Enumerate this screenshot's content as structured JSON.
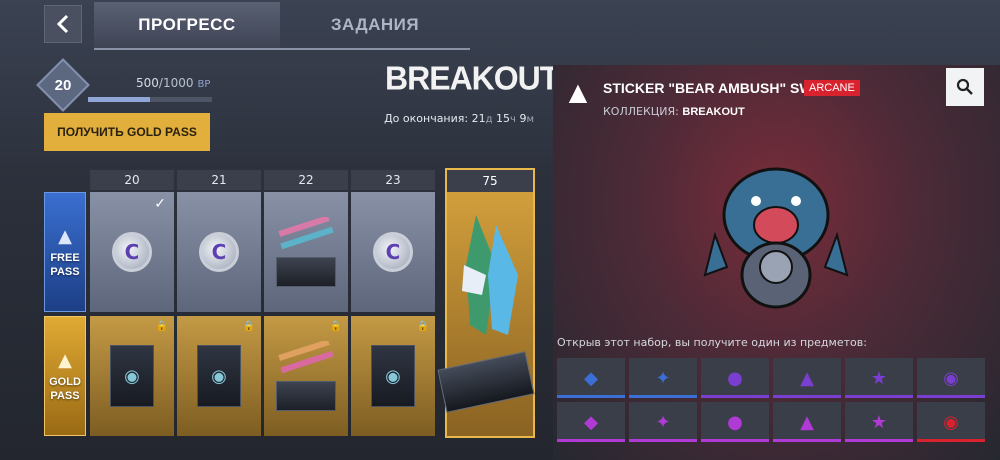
{
  "header": {
    "back_icon": "chevron-left-icon",
    "tabs": [
      {
        "label": "ПРОГРЕСС",
        "active": true
      },
      {
        "label": "ЗАДАНИЯ",
        "active": false
      }
    ]
  },
  "level": {
    "current": "20",
    "bp_current": "500",
    "bp_max": "/1000",
    "bp_unit": "BP",
    "progress": 0.5
  },
  "gold_pass_button": "ПОЛУЧИТЬ GOLD PASS",
  "event": {
    "name": "BREAKOUT",
    "timer_label": "До окончания:",
    "days": "21",
    "days_unit": "д",
    "hours": "15",
    "hours_unit": "ч",
    "minutes": "9",
    "minutes_unit": "м"
  },
  "passes": {
    "free_label_1": "FREE",
    "free_label_2": "PASS",
    "gold_label_1": "GOLD",
    "gold_label_2": "PASS"
  },
  "columns": [
    "20",
    "21",
    "22",
    "23"
  ],
  "column_final": "75",
  "item": {
    "title": "STICKER \"BEAR AMBUSH\" SWAP",
    "rarity": "ARCANE",
    "rarity_color": "#d8222e",
    "collection_label": "КОЛЛЕКЦИЯ:",
    "collection_name": "BREAKOUT"
  },
  "open_text": "Открыв этот набор, вы получите один из предметов:",
  "grid_items": [
    {
      "icon": "sticker-icon",
      "rarity_color": "#3b6fd6"
    },
    {
      "icon": "sticker-icon",
      "rarity_color": "#3b6fd6"
    },
    {
      "icon": "sticker-icon",
      "rarity_color": "#7a3fd0"
    },
    {
      "icon": "sticker-icon",
      "rarity_color": "#7a3fd0"
    },
    {
      "icon": "sticker-icon",
      "rarity_color": "#7a3fd0"
    },
    {
      "icon": "sticker-icon",
      "rarity_color": "#7a3fd0"
    },
    {
      "icon": "sticker-icon",
      "rarity_color": "#b03ad6"
    },
    {
      "icon": "sticker-icon",
      "rarity_color": "#b03ad6"
    },
    {
      "icon": "sticker-icon",
      "rarity_color": "#b03ad6"
    },
    {
      "icon": "sticker-icon",
      "rarity_color": "#b03ad6"
    },
    {
      "icon": "sticker-icon",
      "rarity_color": "#b03ad6"
    },
    {
      "icon": "sticker-icon",
      "rarity_color": "#d8222e"
    }
  ]
}
